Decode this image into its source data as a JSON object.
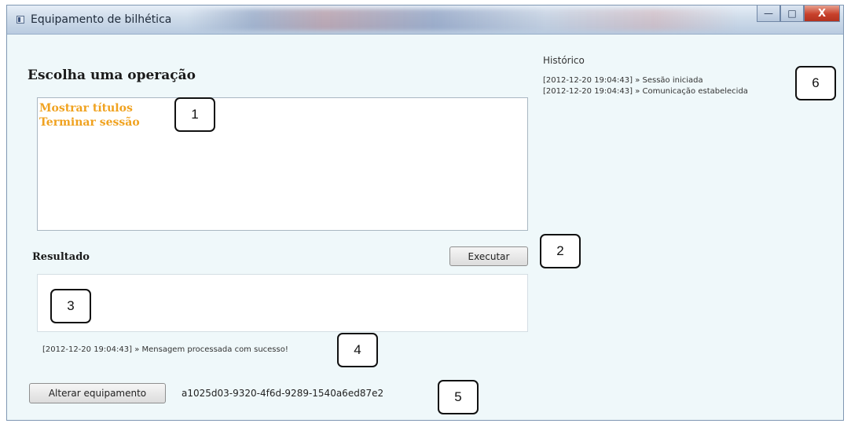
{
  "window": {
    "title": "Equipamento de bilhética",
    "controls": {
      "minimize": "—",
      "maximize": "□",
      "close": "X"
    }
  },
  "operations": {
    "heading": "Escolha uma operação",
    "items": [
      "Mostrar títulos",
      "Terminar sessão"
    ],
    "item_color": "#f0a21f"
  },
  "execute": {
    "label": "Executar"
  },
  "result": {
    "heading": "Resultado",
    "value": ""
  },
  "status": {
    "message": "[2012-12-20 19:04:43] » Mensagem processada com sucesso!"
  },
  "device": {
    "change_label": "Alterar equipamento",
    "id": "a1025d03-9320-4f6d-9289-1540a6ed87e2"
  },
  "history": {
    "heading": "Histórico",
    "entries": [
      "[2012-12-20 19:04:43] » Sessão iniciada",
      "[2012-12-20 19:04:43] » Comunicação estabelecida"
    ]
  },
  "callouts": [
    "1",
    "2",
    "3",
    "4",
    "5",
    "6"
  ]
}
